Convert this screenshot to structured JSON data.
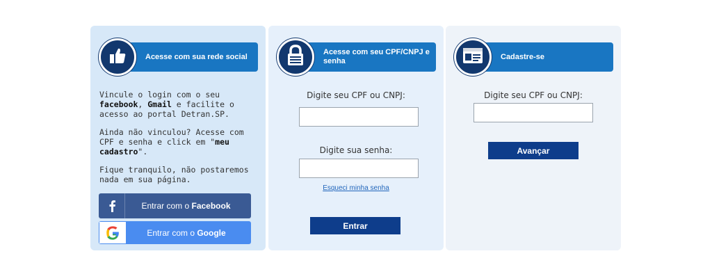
{
  "social": {
    "header_title": "Acesse com sua rede social",
    "para1_pre": "Vincule o login com o seu ",
    "para1_bold1": "facebook",
    "para1_mid": ", ",
    "para1_bold2": "Gmail",
    "para1_post": " e facilite o acesso ao portal Detran.SP.",
    "para2_pre": "Ainda não vinculou? Acesse com CPF e senha e click em \"",
    "para2_bold": "meu cadastro",
    "para2_post": "\".",
    "para3": "Fique tranquilo, não postaremos nada em sua página.",
    "facebook_btn_pre": "Entrar com o ",
    "facebook_btn_bold": "Facebook",
    "google_btn_pre": "Entrar com o ",
    "google_btn_bold": "Google"
  },
  "login": {
    "header_title": "Acesse com seu CPF/CNPJ e senha",
    "cpf_label": "Digite seu CPF ou CNPJ:",
    "cpf_value": "",
    "password_label": "Digite sua senha:",
    "password_value": "",
    "forgot_link": "Esqueci minha senha",
    "submit_label": "Entrar"
  },
  "register": {
    "header_title": "Cadastre-se",
    "cpf_label": "Digite seu CPF ou CNPJ:",
    "cpf_value": "",
    "submit_label": "Avançar"
  },
  "colors": {
    "header_bar": "#1976c2",
    "header_circle": "#12386e",
    "facebook": "#3a5a94",
    "google": "#4a8cf0",
    "primary_button": "#0e3d8b"
  },
  "icons": {
    "social": "thumbs-up-icon",
    "login": "padlock-icon",
    "register": "id-card-icon",
    "facebook": "facebook-f-icon",
    "google": "google-g-icon"
  }
}
